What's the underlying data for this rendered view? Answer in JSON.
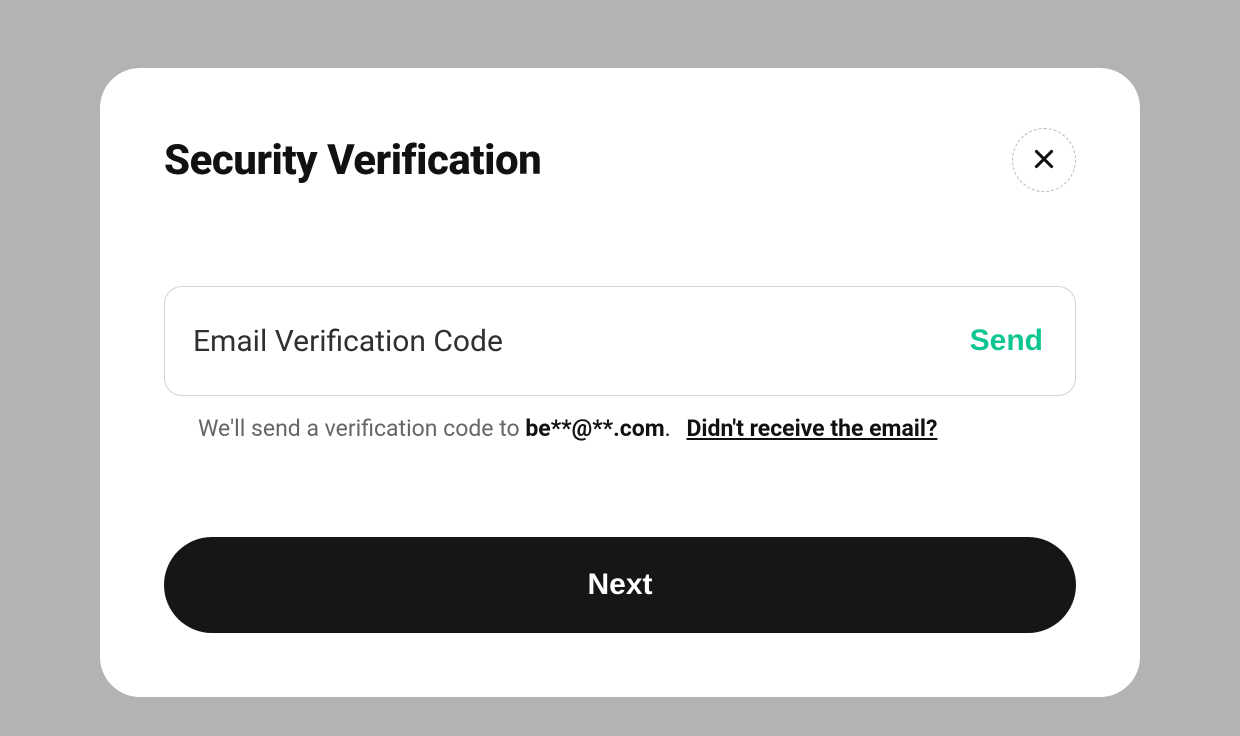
{
  "modal": {
    "title": "Security Verification",
    "close_icon": "close-icon",
    "input": {
      "placeholder": "Email Verification Code",
      "send_label": "Send"
    },
    "helper": {
      "prefix": "We'll send a verification code to ",
      "email": "be**@**.com",
      "period": ".",
      "help_link": "Didn't receive the email?"
    },
    "next_label": "Next"
  },
  "colors": {
    "accent": "#0FC692",
    "background": "#b3b3b3",
    "modal_bg": "#ffffff",
    "primary_button": "#161616"
  }
}
